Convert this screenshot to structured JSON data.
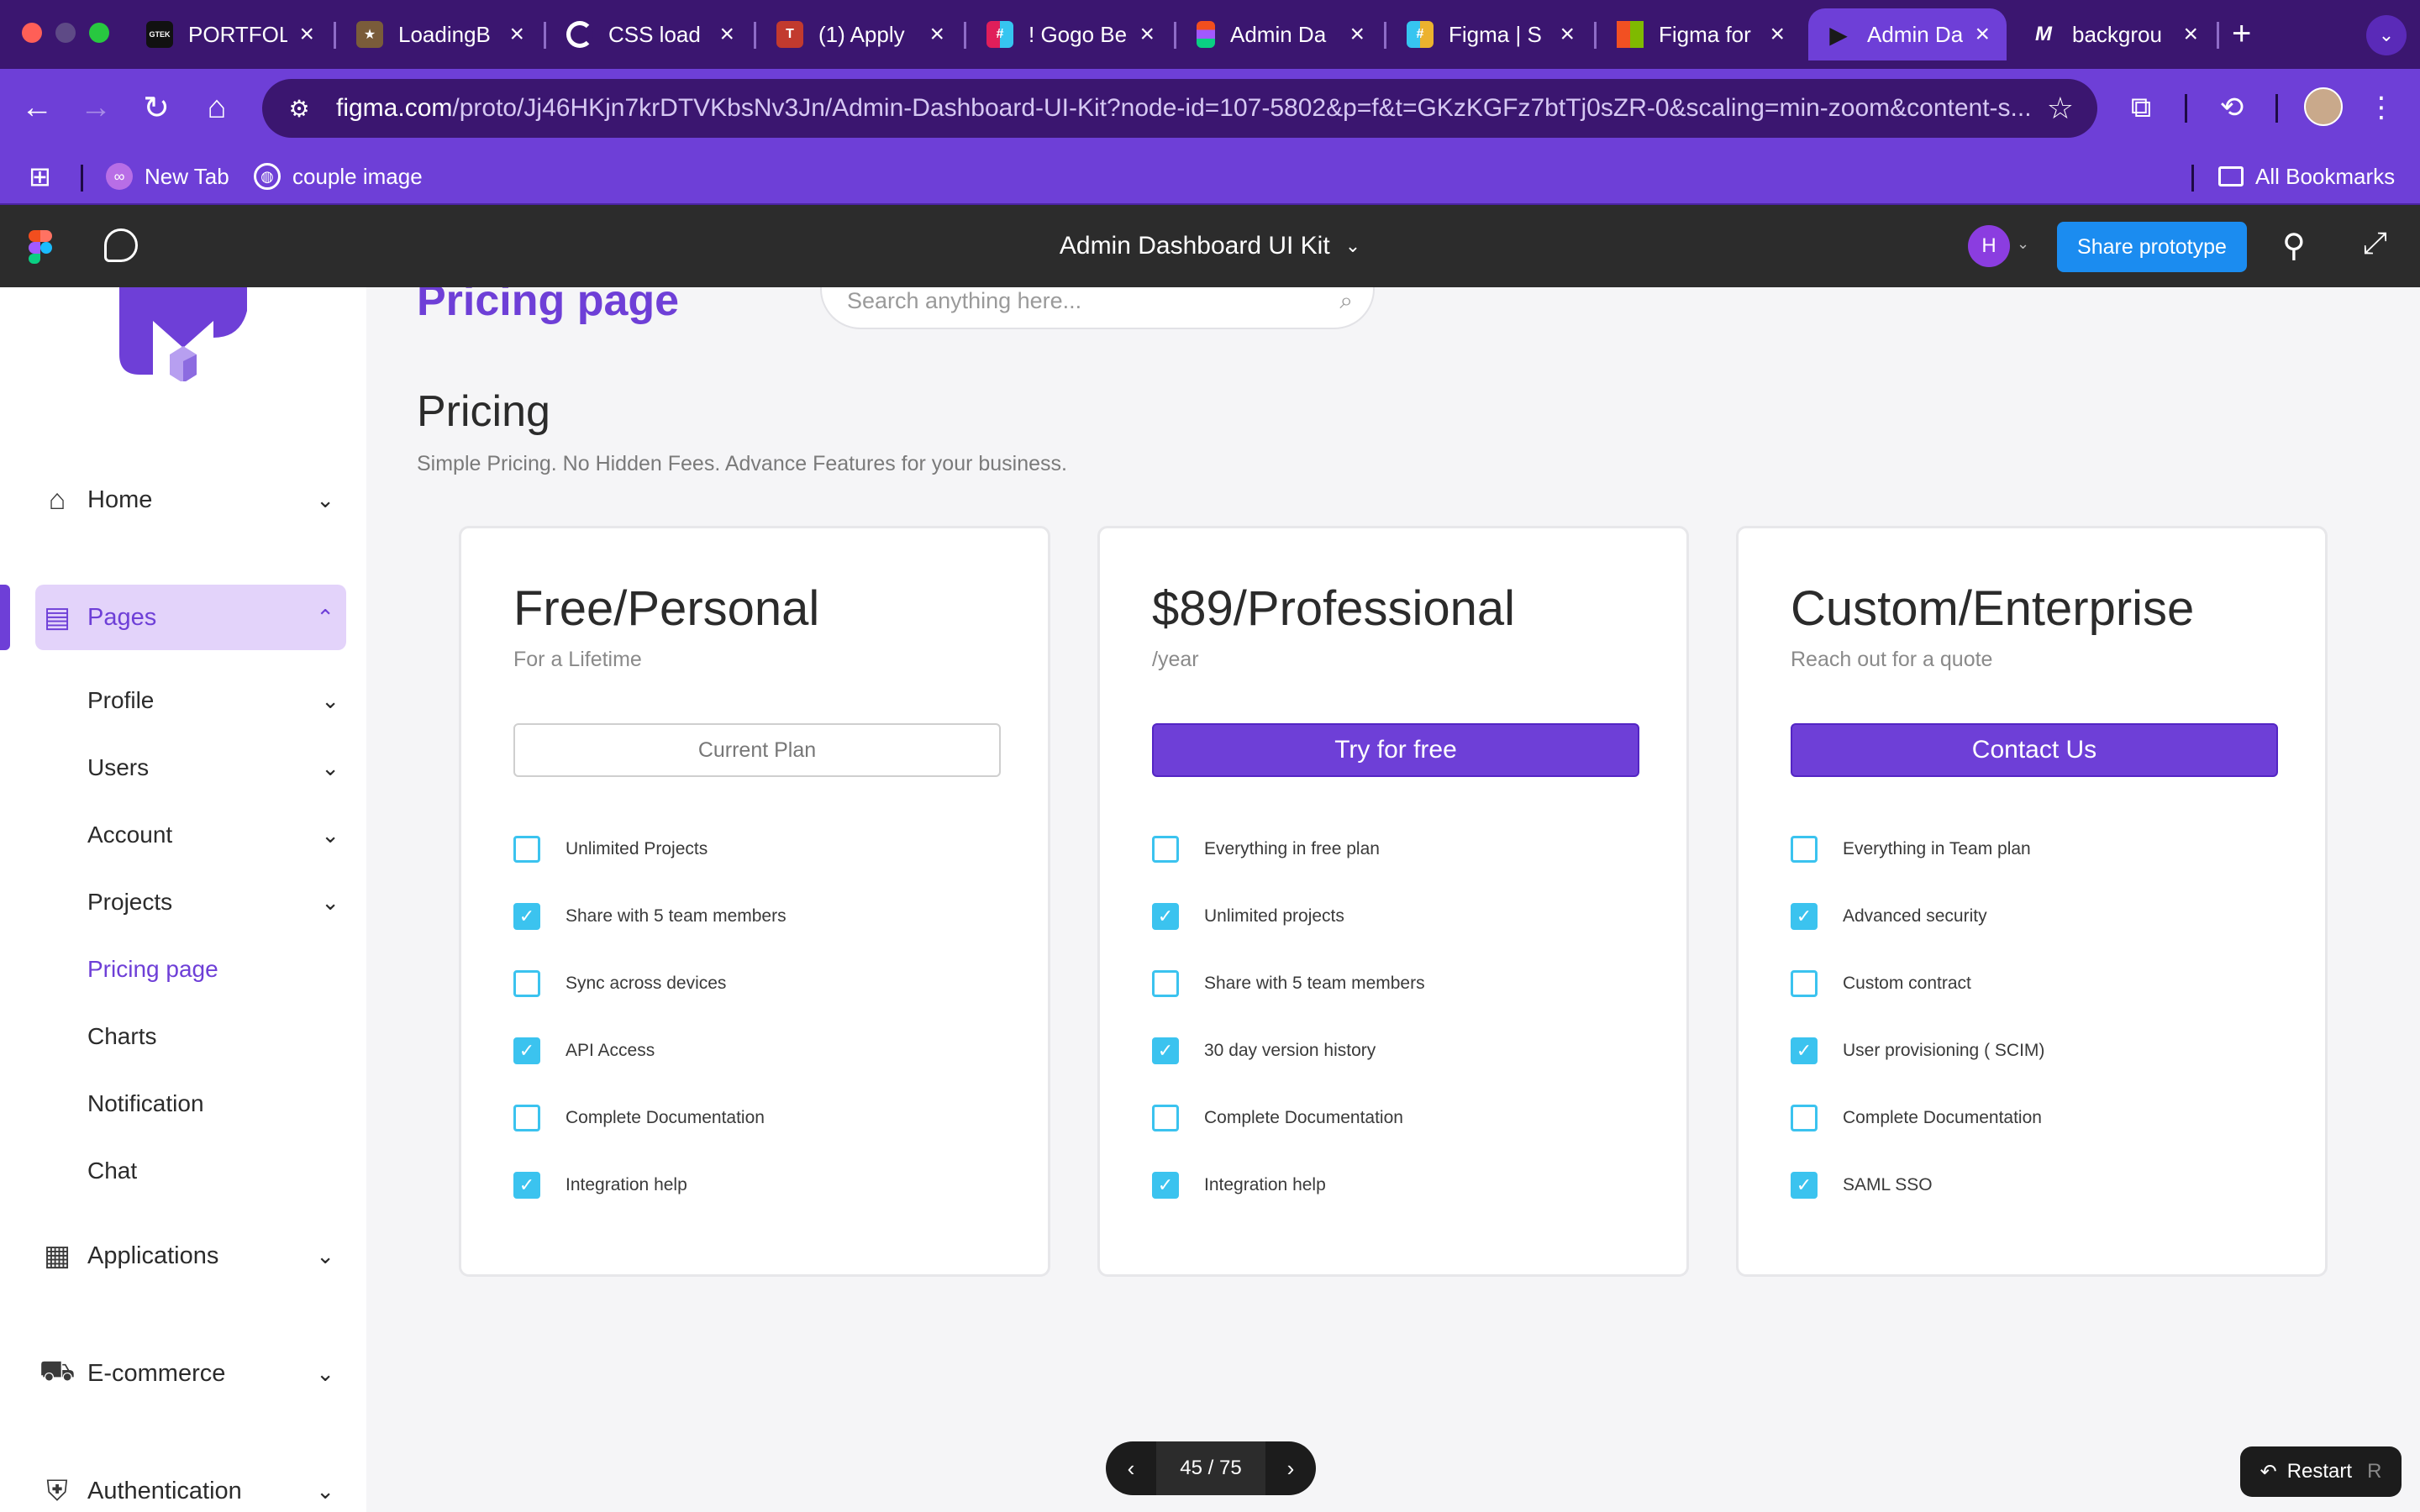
{
  "browser": {
    "tabs": [
      {
        "label": "PORTFOL",
        "icon": "gtek-favicon",
        "color": "#111111"
      },
      {
        "label": "LoadingB",
        "icon": "loadingbar-favicon",
        "color": "#7a5c3a"
      },
      {
        "label": "CSS load",
        "icon": "ring-favicon",
        "color": "#ffffff"
      },
      {
        "label": "(1) Apply",
        "icon": "apply-favicon",
        "color": "#c23a2e"
      },
      {
        "label": "! Gogo Be",
        "icon": "slack-favicon",
        "color": "#e01e5a"
      },
      {
        "label": "Admin Da",
        "icon": "figma-favicon",
        "color": "#f24e1e"
      },
      {
        "label": "Figma | S",
        "icon": "slack-favicon",
        "color": "#36c5f0"
      },
      {
        "label": "Figma for",
        "icon": "microsoft-favicon",
        "color": "#f25022"
      },
      {
        "label": "Admin Da",
        "icon": "play-favicon",
        "color": "#1a1a1a"
      },
      {
        "label": "backgrou",
        "icon": "medium-favicon",
        "color": "#111111"
      }
    ],
    "url_host": "figma.com",
    "url_path": "/proto/Jj46HKjn7krDTVKbsNv3Jn/Admin-Dashboard-UI-Kit?node-id=107-5802&p=f&t=GKzKGFz7btTj0sZR-0&scaling=min-zoom&content-s...",
    "bookmarks": [
      {
        "label": "New Tab",
        "icon": "newtab-icon"
      },
      {
        "label": "couple image",
        "icon": "globe-icon"
      }
    ],
    "all_bookmarks": "All Bookmarks"
  },
  "figma": {
    "title": "Admin Dashboard UI Kit",
    "avatar_initial": "H",
    "share_label": "Share prototype",
    "page_indicator": "45 / 75",
    "restart_label": "Restart",
    "restart_key": "R"
  },
  "sidebar": {
    "items": [
      {
        "label": "Home",
        "icon": "home-icon"
      },
      {
        "label": "Pages",
        "icon": "document-icon"
      },
      {
        "label": "Applications",
        "icon": "archive-icon"
      },
      {
        "label": "E-commerce",
        "icon": "basket-icon"
      },
      {
        "label": "Authentication",
        "icon": "shield-icon"
      }
    ],
    "subitems": [
      "Profile",
      "Users",
      "Account",
      "Projects",
      "Pricing page",
      "Charts",
      "Notification",
      "Chat"
    ]
  },
  "main": {
    "heading": "Pricing page",
    "search_placeholder": "Search anything here...",
    "section_title": "Pricing",
    "section_subtitle": "Simple Pricing. No Hidden Fees. Advance Features for your business."
  },
  "plans": [
    {
      "title": "Free/Personal",
      "subtitle": "For a Lifetime",
      "button": "Current Plan",
      "features": [
        {
          "label": "Unlimited Projects",
          "checked": false
        },
        {
          "label": "Share with 5 team members",
          "checked": true
        },
        {
          "label": "Sync across devices",
          "checked": false
        },
        {
          "label": "API Access",
          "checked": true
        },
        {
          "label": "Complete Documentation",
          "checked": false
        },
        {
          "label": "Integration help",
          "checked": true
        }
      ]
    },
    {
      "title": "$89/Professional",
      "subtitle": "/year",
      "button": "Try for free",
      "features": [
        {
          "label": "Everything in free plan",
          "checked": false
        },
        {
          "label": "Unlimited projects",
          "checked": true
        },
        {
          "label": "Share with 5 team members",
          "checked": false
        },
        {
          "label": "30 day version history",
          "checked": true
        },
        {
          "label": "Complete Documentation",
          "checked": false
        },
        {
          "label": "Integration help",
          "checked": true
        }
      ]
    },
    {
      "title": "Custom/Enterprise",
      "subtitle": "Reach out for a quote",
      "button": "Contact Us",
      "features": [
        {
          "label": "Everything in Team plan",
          "checked": false
        },
        {
          "label": "Advanced security",
          "checked": true
        },
        {
          "label": "Custom contract",
          "checked": false
        },
        {
          "label": "User provisioning ( SCIM)",
          "checked": true
        },
        {
          "label": "Complete Documentation",
          "checked": false
        },
        {
          "label": "SAML SSO",
          "checked": true
        }
      ]
    }
  ],
  "colors": {
    "brand": "#6e3fd7",
    "checkbox": "#3bc3ef",
    "share": "#1b8cf0"
  }
}
